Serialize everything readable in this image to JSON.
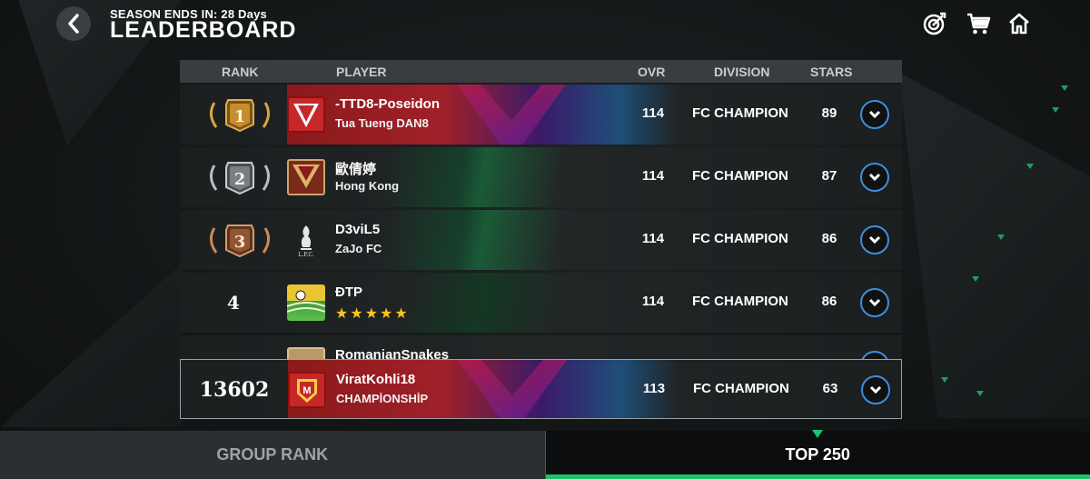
{
  "header": {
    "season_ends": "SEASON ENDS IN: 28 Days",
    "title": "LEADERBOARD",
    "back_icon": "chevron-left-icon",
    "icons": [
      "target-icon",
      "cart-icon",
      "home-icon"
    ]
  },
  "table": {
    "columns": {
      "rank": "RANK",
      "player": "PLAYER",
      "ovr": "OVR",
      "division": "DIVISION",
      "stars": "STARS"
    },
    "rows": [
      {
        "rank": "1",
        "medal": "gold",
        "name": "-TTD8-Poseidon",
        "sub": "Tua Tueng DAN8",
        "ovr": "114",
        "division": "FC CHAMPION",
        "stars": "89"
      },
      {
        "rank": "2",
        "medal": "silver",
        "name": "歐倩婷",
        "sub": "Hong Kong",
        "ovr": "114",
        "division": "FC CHAMPION",
        "stars": "87"
      },
      {
        "rank": "3",
        "medal": "bronze",
        "name": "D3viL5",
        "sub": "ZaJo FC",
        "ovr": "114",
        "division": "FC CHAMPION",
        "stars": "86"
      },
      {
        "rank": "4",
        "medal": "none",
        "name": "ĐTP",
        "sub_rating": 5,
        "ovr": "114",
        "division": "FC CHAMPION",
        "stars": "86"
      },
      {
        "rank": "",
        "medal": "none",
        "name": "RomanianSnakes",
        "sub": "",
        "ovr": "",
        "division": "",
        "stars": ""
      }
    ],
    "you": {
      "rank": "13602",
      "name": "ViratKohli18",
      "sub": "CHAMPİONSHİP",
      "ovr": "113",
      "division": "FC CHAMPION",
      "stars": "63"
    }
  },
  "tabs": {
    "group_rank": "GROUP RANK",
    "top250": "TOP 250",
    "active": "top250"
  },
  "colors": {
    "accent_green": "#1fc16b",
    "expand_blue": "#3d8ee0",
    "gold": "#d9a441",
    "silver": "#b8bcc0",
    "bronze": "#c98a5a",
    "star": "#f7c51e"
  }
}
